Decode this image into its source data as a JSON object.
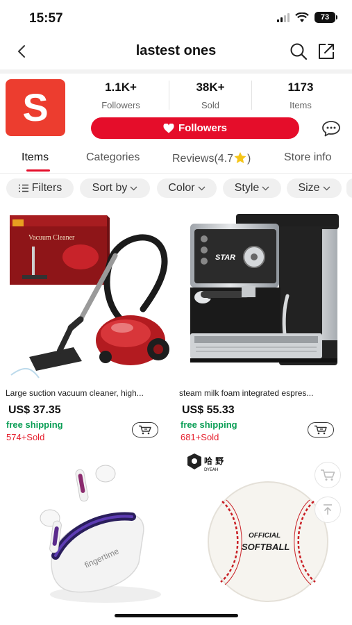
{
  "status": {
    "time": "15:57",
    "battery": "73"
  },
  "nav": {
    "title": "lastest ones"
  },
  "store": {
    "logo_letter": "S",
    "stats": [
      {
        "value": "1.1K+",
        "label": "Followers"
      },
      {
        "value": "38K+",
        "label": "Sold"
      },
      {
        "value": "1173",
        "label": "Items"
      }
    ],
    "follow_label": "Followers"
  },
  "tabs": [
    "Items",
    "Categories",
    "Reviews(4.7",
    "Store info"
  ],
  "filters": [
    "Filters",
    "Sort by",
    "Color",
    "Style",
    "Size"
  ],
  "products": [
    {
      "name": "Large suction vacuum cleaner, high...",
      "price": "US$ 37.35",
      "shipping": "free shipping",
      "sold": "574+Sold"
    },
    {
      "name": "steam milk foam integrated espres...",
      "price": "US$ 55.33",
      "shipping": "free shipping",
      "sold": "681+Sold"
    }
  ],
  "images": {
    "vacuum_box_title": "Vacuum Cleaner",
    "espresso_brand": "STAR",
    "earbuds_brand": "fingertime",
    "ball_text_1": "OFFICIAL",
    "ball_text_2": "SOFTBALL",
    "badge_text": "DYEAH",
    "badge_cn": "哈 野"
  },
  "colors": {
    "accent": "#e50d2a",
    "logo_bg": "#ec3d2f",
    "shipping": "#0a9e55",
    "sold": "#e51e2c"
  }
}
